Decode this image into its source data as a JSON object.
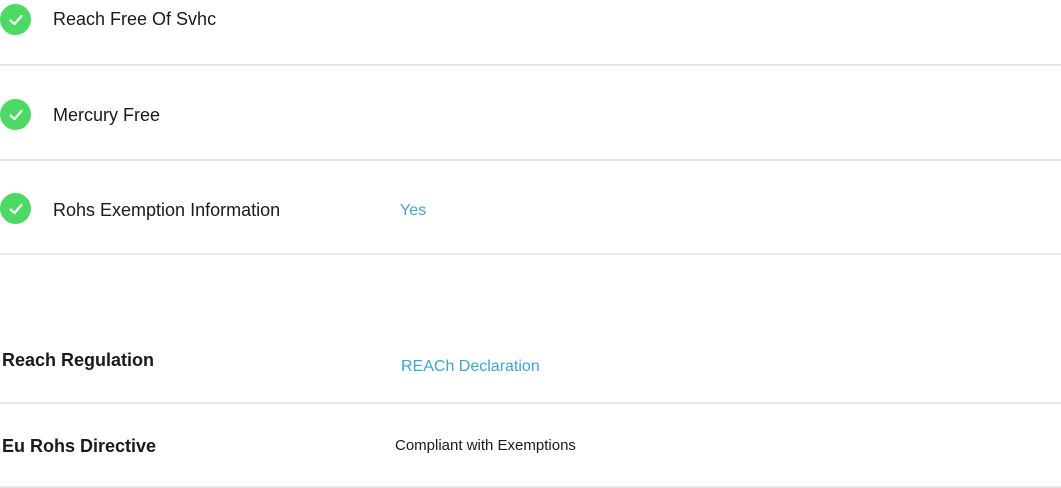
{
  "checks": [
    {
      "label": "Reach Free Of Svhc",
      "value": ""
    },
    {
      "label": "Mercury Free",
      "value": ""
    },
    {
      "label": "Rohs Exemption Information",
      "value": "Yes"
    }
  ],
  "regulations": [
    {
      "label": "Reach Regulation",
      "value": "REACh Declaration"
    },
    {
      "label": "Eu Rohs Directive",
      "value": "Compliant with Exemptions"
    }
  ],
  "colors": {
    "check_green": "#4cd964",
    "link_blue": "#3aa6d8",
    "divider": "#e6e6e6"
  },
  "icons": {
    "check": "check-circle-icon"
  }
}
